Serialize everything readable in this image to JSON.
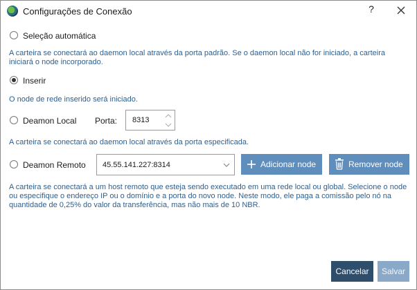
{
  "window": {
    "title": "Configurações de Conexão",
    "help_label": "?",
    "icons": {
      "app": "ecoin-logo-icon",
      "close": "close-icon"
    }
  },
  "options": {
    "auto": {
      "label": "Seleção automática",
      "selected": false,
      "description": "A carteira se conectará ao daemon local através da porta padrão. Se o daemon local não for iniciado, a carteira iniciará o node incorporado."
    },
    "insert": {
      "label": "Inserir",
      "selected": true,
      "description": "O node de rede inserido será iniciado."
    },
    "local": {
      "label": "Deamon Local",
      "selected": false,
      "port_label": "Porta:",
      "port_value": "8313",
      "description": "A carteira se conectará ao daemon local através da porta especificada."
    },
    "remote": {
      "label": "Deamon Remoto",
      "selected": false,
      "host_value": "45.55.141.227:8314",
      "add_label": "Adicionar node",
      "remove_label": "Remover node",
      "description": "A carteira se conectará a um host remoto que esteja sendo executado em uma rede local ou global. Selecione o node ou especifique o endereço IP ou o domínio e a porta do novo node. Neste modo, ele paga a comissão pelo nó na quantidade de 0,25% do valor da transferência, mas não mais de 10 NBR."
    }
  },
  "footer": {
    "cancel_label": "Cancelar",
    "save_label": "Salvar"
  },
  "colors": {
    "accent": "#5f8ebd",
    "accent_dark": "#2e4e6c",
    "accent_disabled": "#8aa9c8",
    "description_text": "#2d5f8f"
  }
}
